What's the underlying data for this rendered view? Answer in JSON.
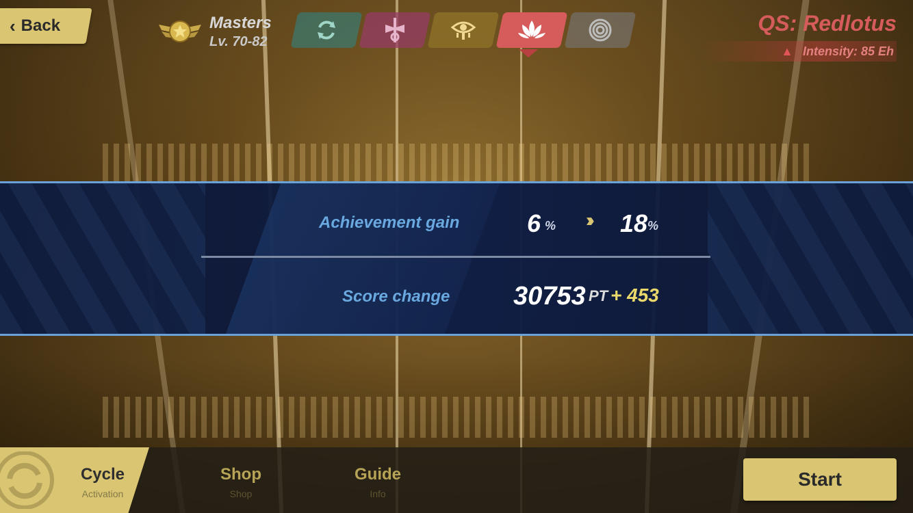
{
  "header": {
    "back_label": "Back",
    "rank_title": "Masters",
    "rank_level": "Lv. 70-82",
    "tabs": [
      {
        "icon": "cycle-icon"
      },
      {
        "icon": "cross-icon"
      },
      {
        "icon": "eye-icon"
      },
      {
        "icon": "lotus-icon",
        "active": true
      },
      {
        "icon": "spiral-icon"
      }
    ],
    "quest_title": "QS: Redlotus",
    "intensity": "Intensity: 85 Eh"
  },
  "panel": {
    "achievement_label": "Achievement gain",
    "achievement_from": "6",
    "achievement_to": "18",
    "percent_symbol": "%",
    "score_label": "Score change",
    "score_value": "30753",
    "score_unit": "PT",
    "score_gain": "+ 453"
  },
  "bottom_nav": {
    "items": [
      {
        "label": "Cycle",
        "sub": "Activation",
        "active": true
      },
      {
        "label": "Shop",
        "sub": "Shop"
      },
      {
        "label": "Guide",
        "sub": "Info"
      }
    ],
    "start_label": "Start"
  },
  "colors": {
    "accent_gold": "#d9c572",
    "active_tab": "#d65c5c",
    "panel_label": "#6aa8e0",
    "gain_yellow": "#ead86b"
  }
}
